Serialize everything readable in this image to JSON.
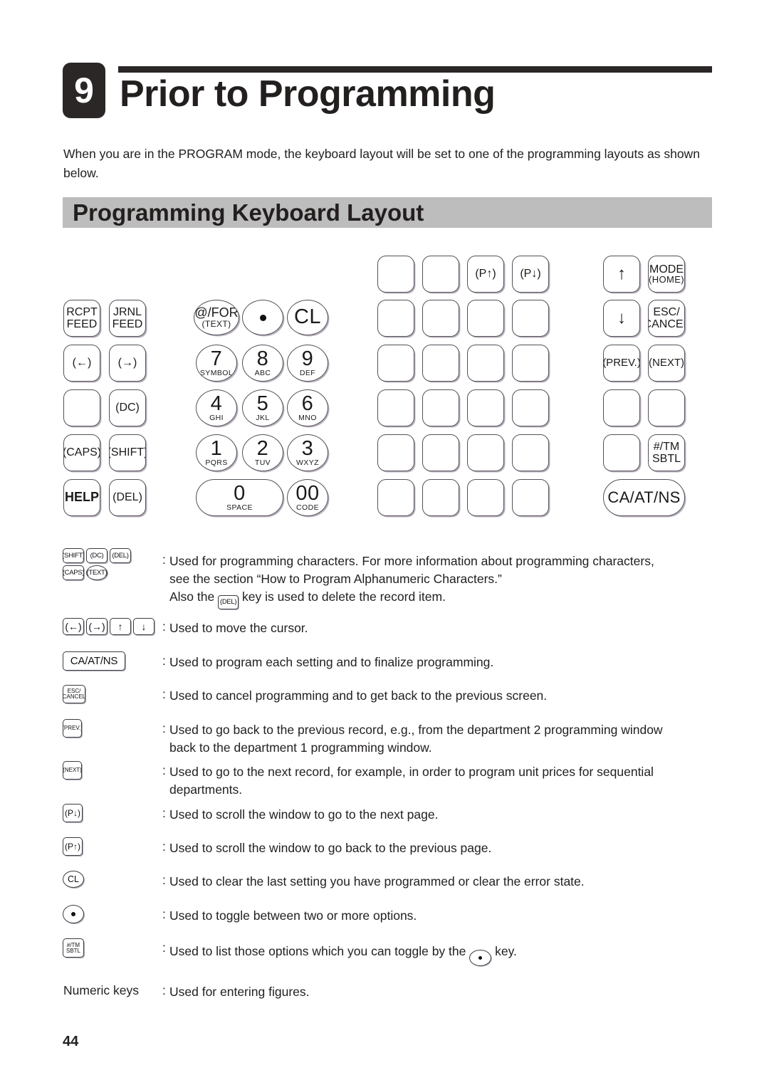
{
  "chapter": {
    "number": "9",
    "title": "Prior to Programming"
  },
  "intro": "When you are in the PROGRAM mode, the keyboard layout will be set to one of the programming layouts as shown below.",
  "section": {
    "title": "Programming Keyboard Layout"
  },
  "keyboard": {
    "left_block": [
      {
        "l1": "RCPT",
        "l2": "FEED"
      },
      {
        "l1": "JRNL",
        "l2": "FEED"
      },
      {
        "l1": "(←)",
        "l2": ""
      },
      {
        "l1": "(→)",
        "l2": ""
      },
      {
        "l1": "",
        "l2": ""
      },
      {
        "l1": "(DC)",
        "l2": ""
      },
      {
        "l1": "(CAPS)",
        "l2": ""
      },
      {
        "l1": "(SHIFT)",
        "l2": ""
      },
      {
        "l1": "HELP",
        "l2": ""
      },
      {
        "l1": "(DEL)",
        "l2": ""
      }
    ],
    "numeric_block": [
      {
        "main": "@/FOR",
        "sub": "(TEXT)"
      },
      {
        "main": "●",
        "sub": ""
      },
      {
        "main": "CL",
        "sub": ""
      },
      {
        "main": "7",
        "sub": "SYMBOL"
      },
      {
        "main": "8",
        "sub": "ABC"
      },
      {
        "main": "9",
        "sub": "DEF"
      },
      {
        "main": "4",
        "sub": "GHI"
      },
      {
        "main": "5",
        "sub": "JKL"
      },
      {
        "main": "6",
        "sub": "MNO"
      },
      {
        "main": "1",
        "sub": "PQRS"
      },
      {
        "main": "2",
        "sub": "TUV"
      },
      {
        "main": "3",
        "sub": "WXYZ"
      },
      {
        "main": "0",
        "sub": "SPACE"
      },
      {
        "main": "00",
        "sub": "CODE"
      }
    ],
    "department_block": [
      "",
      "",
      "(P↑)",
      "(P↓)",
      "",
      "",
      "",
      "",
      "",
      "",
      "",
      "",
      "",
      "",
      "",
      "",
      "",
      "",
      "",
      "",
      "",
      "",
      "",
      ""
    ],
    "right_block": [
      {
        "l1": "↑",
        "l2": ""
      },
      {
        "l1": "MODE",
        "l2": "(HOME)"
      },
      {
        "l1": "↓",
        "l2": ""
      },
      {
        "l1": "ESC/",
        "l2": "CANCEL"
      },
      {
        "l1": "(PREV.)",
        "l2": ""
      },
      {
        "l1": "(NEXT)",
        "l2": ""
      },
      {
        "l1": "",
        "l2": ""
      },
      {
        "l1": "",
        "l2": ""
      },
      {
        "l1": "",
        "l2": ""
      },
      {
        "l1": "#/TM",
        "l2": "SBTL"
      }
    ],
    "ca_at_ns": "CA/AT/NS"
  },
  "descriptions": [
    {
      "icons": [
        "(SHIFT)",
        "(DC)",
        "(DEL)",
        "(CAPS)",
        "(TEXT)"
      ],
      "colon": ":",
      "text_line1": "Used for programming characters. For more information about programming characters,",
      "text_line2": "see the section “How to Program Alphanumeric Characters.”",
      "text_line3_before": "Also the",
      "text_line3_chip": "(DEL)",
      "text_line3_after": "key is used to delete the record item."
    },
    {
      "icons": [
        "(←)",
        "(→)",
        "↑",
        "↓"
      ],
      "colon": ":",
      "text": "Used to move the cursor."
    },
    {
      "icons": [
        "CA/AT/NS"
      ],
      "colon": ":",
      "text": "Used to program each setting and to finalize programming."
    },
    {
      "icons": [
        "ESC/ CANCEL"
      ],
      "colon": ":",
      "text": "Used to cancel programming and to get back to the previous screen."
    },
    {
      "icons": [
        "(PREV.)"
      ],
      "colon": ":",
      "text_line1": "Used to go back to the previous record, e.g., from the department 2 programming window",
      "text_line2": "back to the department 1 programming window."
    },
    {
      "icons": [
        "(NEXT)"
      ],
      "colon": ":",
      "text_line1": "Used to go to the next record, for example, in order to program unit prices for sequential",
      "text_line2": "departments."
    },
    {
      "icons": [
        "(P↓)"
      ],
      "colon": ":",
      "text": "Used to scroll the window to go to the next page."
    },
    {
      "icons": [
        "(P↑)"
      ],
      "colon": ":",
      "text": "Used to scroll the window to go back to the previous page."
    },
    {
      "icons": [
        "CL"
      ],
      "colon": ":",
      "text": "Used to clear the last setting you have programmed or clear the error state."
    },
    {
      "icons": [
        "●"
      ],
      "colon": ":",
      "text": "Used to toggle between two or more options."
    },
    {
      "icons": [
        "#/TM SBTL"
      ],
      "colon": ":",
      "text_before": "Used to list those options which you can toggle by the",
      "text_after": "key."
    },
    {
      "label": "Numeric keys",
      "colon": ":",
      "text": "Used for entering figures."
    }
  ],
  "footer": {
    "page_number": "44"
  },
  "colors": {
    "badge_bg": "#2b2727",
    "band_bg": "#bdbdbd",
    "text": "#232020",
    "key_border": "#55505a"
  }
}
